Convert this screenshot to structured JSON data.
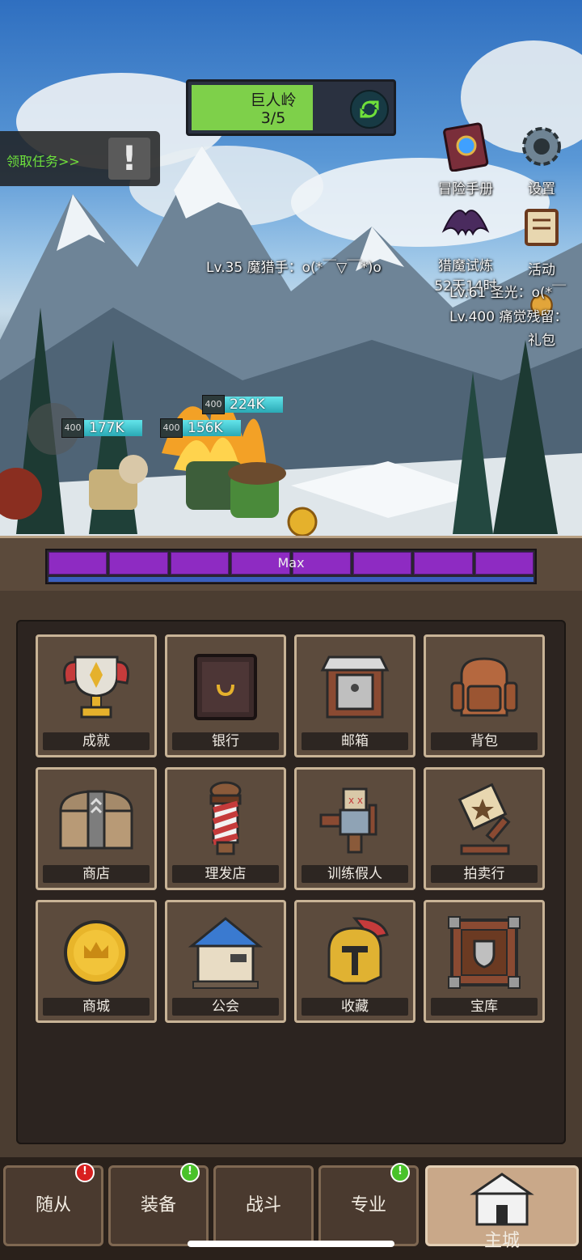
{
  "stage": {
    "name": "巨人岭",
    "progress_text": "3/5",
    "progress": 0.6
  },
  "quest": {
    "label": "领取任务>>",
    "alert": "!"
  },
  "side_buttons": {
    "adventure_book": "冒险手册",
    "settings": "设置",
    "demon_trial": "猎魔试炼",
    "demon_trial_timer": "52天14时",
    "events": "活动",
    "gift_pack": "礼包"
  },
  "system_messages": [
    "Lv.35 魔猎手：o(*￣▽￣*)o",
    "Lv.61 圣光：o(*￣",
    "Lv.400 痛觉残留："
  ],
  "battle": {
    "damage_numbers": [
      {
        "level": "400",
        "value": "224K"
      },
      {
        "level": "400",
        "value": "177K"
      },
      {
        "level": "400",
        "value": "156K"
      }
    ]
  },
  "xp_bar": {
    "label": "Max",
    "segments": 8
  },
  "menu": [
    {
      "label": "成就",
      "icon": "trophy-icon"
    },
    {
      "label": "银行",
      "icon": "safe-icon"
    },
    {
      "label": "邮箱",
      "icon": "mailbox-icon"
    },
    {
      "label": "背包",
      "icon": "backpack-icon"
    },
    {
      "label": "商店",
      "icon": "chest-icon"
    },
    {
      "label": "理发店",
      "icon": "barber-pole-icon"
    },
    {
      "label": "训练假人",
      "icon": "training-dummy-icon"
    },
    {
      "label": "拍卖行",
      "icon": "gavel-icon"
    },
    {
      "label": "商城",
      "icon": "gold-coin-icon"
    },
    {
      "label": "公会",
      "icon": "guild-hall-icon"
    },
    {
      "label": "收藏",
      "icon": "helmet-icon"
    },
    {
      "label": "宝库",
      "icon": "vault-icon"
    }
  ],
  "tabs": [
    {
      "label": "随从",
      "badge": "!",
      "badge_color": "#d82020"
    },
    {
      "label": "装备",
      "badge": "!",
      "badge_color": "#49c22a"
    },
    {
      "label": "战斗"
    },
    {
      "label": "专业",
      "badge": "!",
      "badge_color": "#49c22a"
    },
    {
      "label": "主城",
      "active": true
    }
  ]
}
